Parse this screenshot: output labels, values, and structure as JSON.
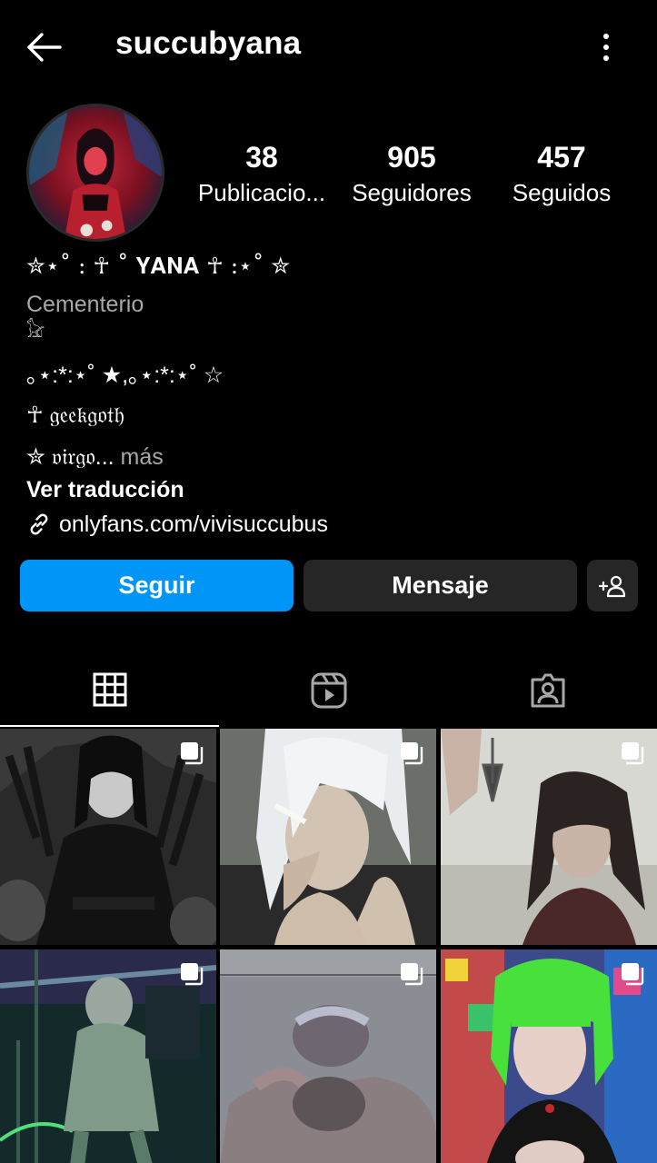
{
  "header": {
    "username": "succubyana",
    "back_icon": "arrow-left-icon",
    "more_icon": "more-vertical-icon"
  },
  "profile": {
    "avatar_icon": "profile-avatar"
  },
  "stats": {
    "posts_count": "38",
    "posts_label": "Publicacio...",
    "followers_count": "905",
    "followers_label": "Seguidores",
    "following_count": "457",
    "following_label": "Seguidos"
  },
  "bio": {
    "name_line": "✮⋆˚ : ☥ ˚ 𝐘𝐀𝐍𝐀 ☥ :⋆˚ ✮",
    "category": "Cementerio",
    "glyph_line": "𓃠",
    "stars_line": "｡⋆:*:⋆˚ ★,｡⋆:*:⋆˚ ☆",
    "geek_line": "☥ 𝔤𝔢𝔢𝔨𝔤𝔬𝔱𝔥",
    "virgo_line": "✮ 𝔳𝔦𝔯𝔤𝔬...",
    "more_label": " más",
    "translate_label": "Ver traducción",
    "link": "onlyfans.com/vivisuccubus"
  },
  "actions": {
    "follow_label": "Seguir",
    "message_label": "Mensaje"
  },
  "colors": {
    "background": "#000000",
    "accent": "#0095f6",
    "secondary_button": "#262626",
    "muted_text": "#a8a8a8"
  },
  "tabs": [
    {
      "name": "grid",
      "icon": "grid-icon"
    },
    {
      "name": "reels",
      "icon": "reels-icon"
    },
    {
      "name": "tagged",
      "icon": "tagged-icon"
    }
  ]
}
